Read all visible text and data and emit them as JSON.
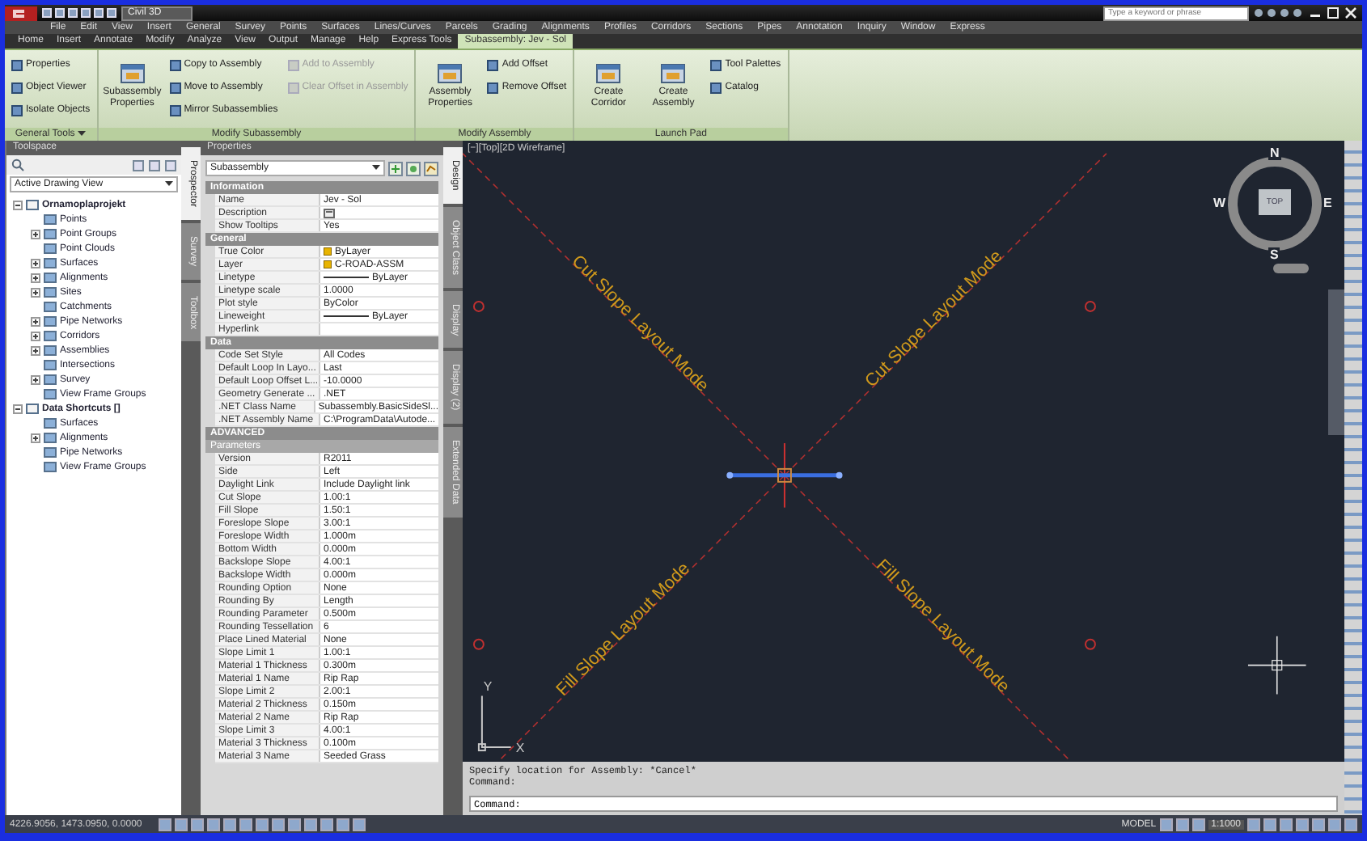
{
  "title_bar": {
    "app_name": "Civil 3D",
    "search_placeholder": "Type a keyword or phrase"
  },
  "menu_bar": [
    "File",
    "Edit",
    "View",
    "Insert",
    "General",
    "Survey",
    "Points",
    "Surfaces",
    "Lines/Curves",
    "Parcels",
    "Grading",
    "Alignments",
    "Profiles",
    "Corridors",
    "Sections",
    "Pipes",
    "Annotation",
    "Inquiry",
    "Window",
    "Express"
  ],
  "ribbon_tabs": [
    {
      "label": "Home",
      "selected": false
    },
    {
      "label": "Insert",
      "selected": false
    },
    {
      "label": "Annotate",
      "selected": false
    },
    {
      "label": "Modify",
      "selected": false
    },
    {
      "label": "Analyze",
      "selected": false
    },
    {
      "label": "View",
      "selected": false
    },
    {
      "label": "Output",
      "selected": false
    },
    {
      "label": "Manage",
      "selected": false
    },
    {
      "label": "Help",
      "selected": false
    },
    {
      "label": "Express Tools",
      "selected": false
    },
    {
      "label": "Subassembly: Jev - Sol",
      "selected": true
    }
  ],
  "ribbon_panels": [
    {
      "title": "General Tools",
      "dropdown": true,
      "tools": [
        {
          "label": "Properties",
          "kind": "small",
          "disabled": false
        },
        {
          "label": "Object Viewer",
          "kind": "small",
          "disabled": false
        },
        {
          "label": "Isolate Objects",
          "kind": "small",
          "disabled": false
        }
      ]
    },
    {
      "title": "Modify Subassembly",
      "dropdown": false,
      "tools": [
        {
          "label": "Subassembly Properties",
          "kind": "large",
          "disabled": false
        },
        {
          "label": "Copy to Assembly",
          "kind": "small",
          "disabled": false
        },
        {
          "label": "Move to Assembly",
          "kind": "small",
          "disabled": false
        },
        {
          "label": "Mirror Subassemblies",
          "kind": "small",
          "disabled": false
        },
        {
          "label": "Add to Assembly",
          "kind": "small",
          "disabled": true
        },
        {
          "label": "Clear Offset in Assembly",
          "kind": "small",
          "disabled": true
        }
      ]
    },
    {
      "title": "Modify Assembly",
      "dropdown": false,
      "tools": [
        {
          "label": "Assembly Properties",
          "kind": "large",
          "disabled": false
        },
        {
          "label": "Add Offset",
          "kind": "small",
          "disabled": false
        },
        {
          "label": "Remove Offset",
          "kind": "small",
          "disabled": false
        }
      ]
    },
    {
      "title": "Launch Pad",
      "dropdown": false,
      "tools": [
        {
          "label": "Create Corridor",
          "kind": "large",
          "disabled": false
        },
        {
          "label": "Create Assembly",
          "kind": "large",
          "disabled": false
        },
        {
          "label": "Tool Palettes",
          "kind": "small",
          "disabled": false
        },
        {
          "label": "Catalog",
          "kind": "small",
          "disabled": false
        }
      ]
    }
  ],
  "toolspace": {
    "title": "Toolspace",
    "view_dropdown": "Active Drawing View",
    "tree": [
      {
        "label": "Ornamoplaprojekt",
        "expanded": true,
        "children": [
          {
            "label": "Points"
          },
          {
            "label": "Point Groups",
            "expanded": false
          },
          {
            "label": "Point Clouds"
          },
          {
            "label": "Surfaces",
            "expanded": false
          },
          {
            "label": "Alignments",
            "expanded": false
          },
          {
            "label": "Sites",
            "expanded": false
          },
          {
            "label": "Catchments"
          },
          {
            "label": "Pipe Networks",
            "expanded": false
          },
          {
            "label": "Corridors",
            "expanded": false
          },
          {
            "label": "Assemblies",
            "expanded": false
          },
          {
            "label": "Intersections"
          },
          {
            "label": "Survey",
            "expanded": false
          },
          {
            "label": "View Frame Groups"
          }
        ]
      },
      {
        "label": "Data Shortcuts []",
        "expanded": true,
        "children": [
          {
            "label": "Surfaces"
          },
          {
            "label": "Alignments",
            "expanded": false
          },
          {
            "label": "Pipe Networks"
          },
          {
            "label": "View Frame Groups"
          }
        ]
      }
    ],
    "tabs": [
      {
        "label": "Prospector",
        "selected": true
      },
      {
        "label": "Survey",
        "selected": false
      },
      {
        "label": "Toolbox",
        "selected": false
      }
    ]
  },
  "properties": {
    "title": "Properties",
    "selector": "Subassembly",
    "sections": [
      {
        "title": "Information",
        "kind": "category",
        "rows": [
          {
            "name": "Name",
            "value": "Jev - Sol"
          },
          {
            "name": "Description",
            "kind": "button"
          },
          {
            "name": "Show Tooltips",
            "value": "Yes"
          }
        ]
      },
      {
        "title": "General",
        "kind": "category",
        "rows": [
          {
            "name": "True Color",
            "value": "ByLayer",
            "kind": "swatch"
          },
          {
            "name": "Layer",
            "value": "C-ROAD-ASSM",
            "kind": "swatch"
          },
          {
            "name": "Linetype",
            "value": "ByLayer",
            "kind": "line"
          },
          {
            "name": "Linetype scale",
            "value": "1.0000"
          },
          {
            "name": "Plot style",
            "value": "ByColor"
          },
          {
            "name": "Lineweight",
            "value": "ByLayer",
            "kind": "line"
          },
          {
            "name": "Hyperlink"
          }
        ]
      },
      {
        "title": "Data",
        "kind": "category",
        "rows": [
          {
            "name": "Code Set Style",
            "value": "All Codes"
          },
          {
            "name": "Default Loop In Layo...",
            "value": "Last"
          },
          {
            "name": "Default Loop Offset L...",
            "value": "-10.0000"
          },
          {
            "name": "Geometry Generate ...",
            "value": ".NET"
          },
          {
            "name": ".NET Class Name",
            "value": "Subassembly.BasicSideSl..."
          },
          {
            "name": ".NET Assembly Name",
            "value": "C:\\ProgramData\\Autode..."
          }
        ]
      },
      {
        "title": "ADVANCED",
        "kind": "category"
      },
      {
        "title": "Parameters",
        "kind": "subcategory",
        "rows": [
          {
            "name": "Version",
            "value": "R2011"
          },
          {
            "name": "Side",
            "value": "Left"
          },
          {
            "name": "Daylight Link",
            "value": "Include Daylight link"
          },
          {
            "name": "Cut Slope",
            "value": "1.00:1"
          },
          {
            "name": "Fill Slope",
            "value": "1.50:1"
          },
          {
            "name": "Foreslope Slope",
            "value": "3.00:1"
          },
          {
            "name": "Foreslope Width",
            "value": "1.000m"
          },
          {
            "name": "Bottom Width",
            "value": "0.000m"
          },
          {
            "name": "Backslope Slope",
            "value": "4.00:1"
          },
          {
            "name": "Backslope Width",
            "value": "0.000m"
          },
          {
            "name": "Rounding Option",
            "value": "None"
          },
          {
            "name": "Rounding By",
            "value": "Length"
          },
          {
            "name": "Rounding Parameter",
            "value": "0.500m"
          },
          {
            "name": "Rounding Tessellation",
            "value": "6"
          },
          {
            "name": "Place Lined Material",
            "value": "None"
          },
          {
            "name": "Slope Limit 1",
            "value": "1.00:1"
          },
          {
            "name": "Material 1 Thickness",
            "value": "0.300m"
          },
          {
            "name": "Material 1 Name",
            "value": "Rip Rap"
          },
          {
            "name": "Slope Limit 2",
            "value": "2.00:1"
          },
          {
            "name": "Material 2 Thickness",
            "value": "0.150m"
          },
          {
            "name": "Material 2 Name",
            "value": "Rip Rap"
          },
          {
            "name": "Slope Limit 3",
            "value": "4.00:1"
          },
          {
            "name": "Material 3 Thickness",
            "value": "0.100m"
          },
          {
            "name": "Material 3 Name",
            "value": "Seeded Grass"
          }
        ]
      }
    ],
    "tabs": [
      {
        "label": "Design",
        "selected": true
      },
      {
        "label": "Object Class",
        "selected": false
      },
      {
        "label": "Display",
        "selected": false
      },
      {
        "label": "Display (2)",
        "selected": false
      },
      {
        "label": "Extended Data",
        "selected": false
      }
    ]
  },
  "viewport": {
    "view_label": "[−][Top][2D Wireframe]",
    "viewcube": {
      "north": "N",
      "south": "S",
      "east": "E",
      "west": "W",
      "face": "TOP"
    },
    "layout_labels": [
      "Cut Slope Layout Mode",
      "Cut Slope Layout Mode",
      "Fill Slope Layout Mode",
      "Fill Slope Layout Mode"
    ],
    "ucs": {
      "y": "Y",
      "x": "X"
    }
  },
  "command_line": {
    "history": [
      "Specify location for Assembly: *Cancel*",
      "Command:"
    ],
    "prompt": "Command:"
  },
  "status_bar": {
    "coordinates": "4226.9056, 1473.0950, 0.0000",
    "space": "MODEL",
    "scale": "1:1000"
  }
}
